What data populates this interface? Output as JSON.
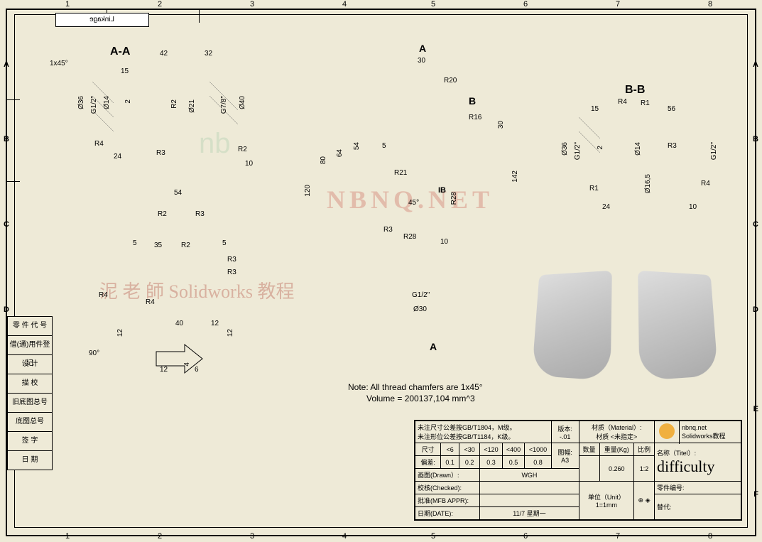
{
  "tab_title": "Linkage",
  "columns": [
    "1",
    "2",
    "3",
    "4",
    "5",
    "6",
    "7",
    "8"
  ],
  "rows": [
    "A",
    "B",
    "C",
    "D",
    "E",
    "F"
  ],
  "sidebar": [
    "零 件 代 号",
    "借(通)用件登记",
    "设 计",
    "描 校",
    "旧底图总号",
    "底图总号",
    "签 字",
    "日 期"
  ],
  "sections": {
    "aa": "A-A",
    "bb": "B-B"
  },
  "arrows": {
    "a_top": "A",
    "a_bot": "A",
    "b": "B",
    "ib": "IB"
  },
  "dimensions": {
    "aa": {
      "chamfer": "1x45°",
      "d36": "Ø36",
      "g12a": "G1/2\"",
      "d14": "Ø14",
      "v2": "2",
      "h15": "15",
      "h42": "42",
      "h32": "32",
      "r2a": "R2",
      "d21": "Ø21",
      "g78": "G7/8\"",
      "d40": "Ø40",
      "r4a": "R4",
      "h24": "24",
      "r3a": "R3",
      "r2b": "R2",
      "h10": "10",
      "h54": "54",
      "r2c": "R2",
      "r3b": "R3",
      "h35": "35",
      "r2d": "R2",
      "h5a": "5",
      "h5b": "5",
      "r3c": "R3",
      "r3d": "R3"
    },
    "bottom": {
      "r4b": "R4",
      "r4c": "R4",
      "a90": "90°",
      "v12a": "12",
      "v12b": "12",
      "h40": "40",
      "h12a": "12",
      "h12b": "12",
      "v4": "4",
      "h6": "6"
    },
    "center": {
      "h30": "30",
      "r20": "R20",
      "r16": "R16",
      "v30": "30",
      "v142": "142",
      "v120": "120",
      "v80": "80",
      "v64": "64",
      "v54": "54",
      "h5": "5",
      "r21": "R21",
      "a45": "45°",
      "r28a": "R28",
      "r28b": "R28",
      "r3": "R3",
      "h10": "10",
      "g12": "G1/2\"",
      "d30": "Ø30"
    },
    "bb": {
      "h15": "15",
      "r4": "R4",
      "r1a": "R1",
      "h56": "56",
      "d36": "Ø36",
      "g12a": "G1/2\"",
      "v2": "2",
      "d14": "Ø14",
      "r3": "R3",
      "g12b": "G1/2\"",
      "r1b": "R1",
      "d165": "Ø16,5",
      "r4b": "R4",
      "h24": "24",
      "h10": "10"
    }
  },
  "notes": {
    "line1": "Note:  All thread chamfers are 1x45°",
    "line2": "Volume = 200137,104 mm^3"
  },
  "watermark": {
    "text1": "泥 老 師 Solidworks 教程",
    "text2": "NBNQ.NET",
    "logo": "nb"
  },
  "title_block": {
    "tol1": "未注尺寸公差按GB/T1804，M级。",
    "tol2": "未注形位公差按GB/T1184，K级。",
    "ver_h": "版本:",
    "ver": "-.01",
    "mat_h": "材质（Material）:",
    "mat": "材质 <未指定>",
    "site": "nbnq.net",
    "tutorial": "Solidworks教程",
    "dim_h": "尺寸",
    "d1": "<6",
    "d2": "<30",
    "d3": "<120",
    "d4": "<400",
    "d5": "<1000",
    "tol_h": "偏差:",
    "t1": "0.1",
    "t2": "0.2",
    "t3": "0.3",
    "t4": "0.5",
    "t5": "0.8",
    "sheet_h": "图幅:",
    "sheet": "A3",
    "qty_h": "数量",
    "wt_h": "重量(Kg)",
    "wt": "0.260",
    "scale_h": "比例",
    "scale": "1:2",
    "name_h": "名称（Titel）:",
    "name": "difficulty",
    "drawn_h": "画图(Drawn）:",
    "drawn": "WGH",
    "chk_h": "校核(Checked):",
    "appr_h": "批准(MFB APPR):",
    "date_h": "日期(DATE):",
    "date": "11/7 星期一",
    "unit_h": "单位（Unit）",
    "unit": "1=1mm",
    "partno_h": "零件编号:",
    "rep_h": "替代:"
  }
}
